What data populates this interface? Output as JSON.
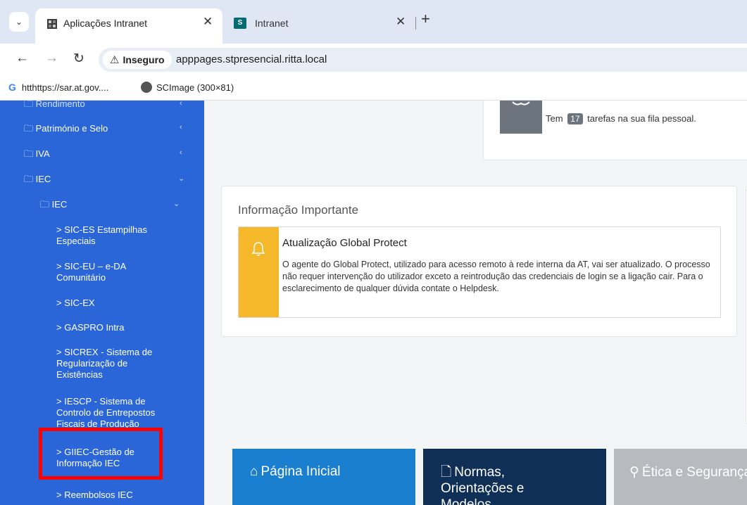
{
  "browser": {
    "tabs": [
      {
        "title": "Aplicações Intranet",
        "active": true
      },
      {
        "title": "Intranet",
        "active": false
      }
    ],
    "security_label": "Inseguro",
    "url": "apppages.stpresencial.ritta.local",
    "bookmarks": [
      {
        "label": "htthttps://sar.at.gov...."
      },
      {
        "label": "SCImage (300×81)"
      }
    ]
  },
  "sidebar": {
    "items": [
      {
        "label": "Rendimento"
      },
      {
        "label": "Património e Selo"
      },
      {
        "label": "IVA"
      },
      {
        "label": "IEC"
      },
      {
        "label": "IEC"
      },
      {
        "label": "> SIC-ES Estampilhas Especiais"
      },
      {
        "label": "> SIC-EU – e-DA Comunitário"
      },
      {
        "label": "> SIC-EX"
      },
      {
        "label": "> GASPRO Intra"
      },
      {
        "label": "> SICREX - Sistema de Regularização de Existências"
      },
      {
        "label": "> IESCP - Sistema de Controlo de Entrepostos Fiscais de Produção"
      },
      {
        "label": "> GIIEC-Gestão de Informação IEC"
      },
      {
        "label": "> Reembolsos IEC"
      }
    ]
  },
  "tasks": {
    "prefix": "Tem",
    "count": "17",
    "suffix": "tarefas na sua fila pessoal."
  },
  "info": {
    "title": "Informação Importante",
    "alert_title": "Atualização Global Protect",
    "alert_body": "O agente do Global Protect, utilizado para acesso remoto à rede interna da AT, vai ser atualizado. O processo não requer intervenção do utilizador exceto a reintrodução das credenciais de login se a ligação cair. Para o esclarecimento de qualquer dúvida contate o Helpdesk."
  },
  "tiles": [
    {
      "label": "Página Inicial",
      "color": "#1a7fcf"
    },
    {
      "label": "Normas, Orientações e Modelos",
      "color": "#0f2f57"
    },
    {
      "label": "Ética e Segurança",
      "color": "#b7bbc0"
    }
  ]
}
